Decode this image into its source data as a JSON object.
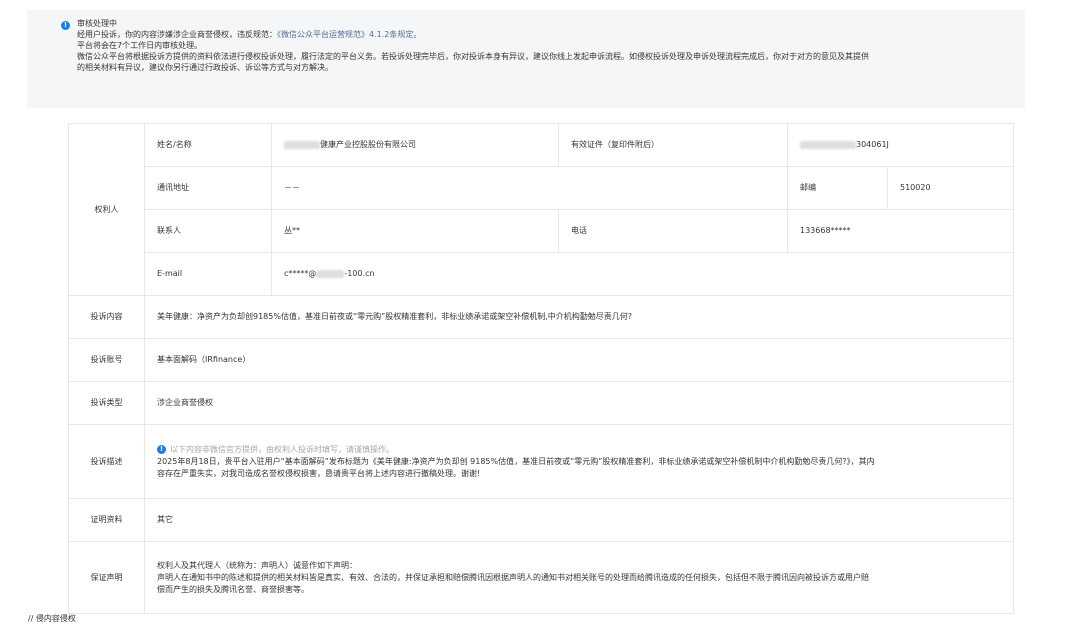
{
  "notice": {
    "title": "审核处理中",
    "line1_prefix": "经用户投诉，你的内容涉嫌涉企业商誉侵权，违反规范：",
    "line1_link": "《微信公众平台运营规范》4.1.2条规定。",
    "line2": "平台将会在7个工作日内审核处理。",
    "line3": "微信公众平台将根据投诉方提供的资料依法进行侵权投诉处理，履行法定的平台义务。若投诉处理完毕后，你对投诉本身有异议，建议你线上发起申诉流程。如侵权投诉处理及申诉处理流程完成后，你对于对方的意见及其提供",
    "line4": "的相关材料有异议，建议你另行通过行政投诉、诉讼等方式与对方解决。"
  },
  "rights_holder": {
    "section_label": "权利人",
    "name_label": "姓名/名称",
    "name_value": "健康产业控股股份有限公司",
    "cert_label": "有效证件（复印件附后）",
    "cert_value": "304061J",
    "address_label": "通讯地址",
    "address_value": "－－",
    "postcode_label": "邮编",
    "postcode_value": "510020",
    "contact_label": "联系人",
    "contact_value": "丛**",
    "phone_label": "电话",
    "phone_value": "133668*****",
    "email_label": "E-mail",
    "email_value_prefix": "c*****@",
    "email_value_suffix": "-100.cn"
  },
  "rows": {
    "content_label": "投诉内容",
    "content_value": "美年健康：净资产为负却创9185%估值，基准日前夜或“零元购”股权精准套利，非标业绩承诺或架空补偿机制,中介机构勤勉尽责几何?",
    "account_label": "投诉账号",
    "account_value": "基本面解码（IRfinance）",
    "type_label": "投诉类型",
    "type_value": "涉企业商誉侵权",
    "desc_label": "投诉描述",
    "desc_tip": "以下内容非微信官方提供，由权利人投诉时填写，请谨慎操作。",
    "desc_line1": "2025年8月18日，贵平台入驻用户“基本面解码”发布标题为《美年健康:净资产为负却创 9185%估值，基准日前夜或“零元购”股权精准套利，非标业绩承诺或架空补偿机制中介机构勤勉尽责几何?》，其内",
    "desc_line2": "容存在严重失实，对我司造成名誉权侵权损害，恳请贵平台将上述内容进行撤稿处理。谢谢!",
    "evidence_label": "证明资料",
    "evidence_value": "其它",
    "guarantee_label": "保证声明",
    "guarantee_line1": "权利人及其代理人（统称为：声明人）诚意作如下声明：",
    "guarantee_line2": "声明人在通知书中的陈述和提供的相关材料皆是真实、有效、合法的，并保证承担和赔偿腾讯因根据声明人的通知书对相关账号的处理而给腾讯造成的任何损失，包括但不限于腾讯因向被投诉方或用户赔",
    "guarantee_line3": "偿而产生的损失及腾讯名誉、商誉损害等。"
  },
  "footer_cut": "// 侵内容侵权"
}
